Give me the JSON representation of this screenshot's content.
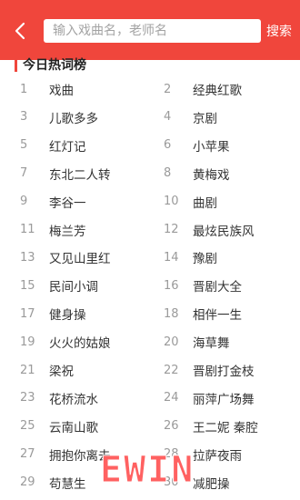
{
  "header": {
    "search_placeholder": "输入戏曲名，老师名",
    "search_button": "搜索",
    "accent_color": "#f0463c"
  },
  "section": {
    "title": "今日热词榜"
  },
  "hot_words": [
    {
      "rank": "1",
      "word": "戏曲"
    },
    {
      "rank": "2",
      "word": "经典红歌"
    },
    {
      "rank": "3",
      "word": "儿歌多多"
    },
    {
      "rank": "4",
      "word": "京剧"
    },
    {
      "rank": "5",
      "word": "红灯记"
    },
    {
      "rank": "6",
      "word": "小苹果"
    },
    {
      "rank": "7",
      "word": "东北二人转"
    },
    {
      "rank": "8",
      "word": "黄梅戏"
    },
    {
      "rank": "9",
      "word": "李谷一"
    },
    {
      "rank": "10",
      "word": "曲剧"
    },
    {
      "rank": "11",
      "word": "梅兰芳"
    },
    {
      "rank": "12",
      "word": "最炫民族风"
    },
    {
      "rank": "13",
      "word": "又见山里红"
    },
    {
      "rank": "14",
      "word": "豫剧"
    },
    {
      "rank": "15",
      "word": "民间小调"
    },
    {
      "rank": "16",
      "word": "晋剧大全"
    },
    {
      "rank": "17",
      "word": "健身操"
    },
    {
      "rank": "18",
      "word": "相伴一生"
    },
    {
      "rank": "19",
      "word": "火火的姑娘"
    },
    {
      "rank": "20",
      "word": "海草舞"
    },
    {
      "rank": "21",
      "word": "梁祝"
    },
    {
      "rank": "22",
      "word": "晋剧打金枝"
    },
    {
      "rank": "23",
      "word": "花桥流水"
    },
    {
      "rank": "24",
      "word": "丽萍广场舞"
    },
    {
      "rank": "25",
      "word": "云南山歌"
    },
    {
      "rank": "26",
      "word": "王二妮 秦腔"
    },
    {
      "rank": "27",
      "word": "拥抱你离去"
    },
    {
      "rank": "28",
      "word": "拉萨夜雨"
    },
    {
      "rank": "29",
      "word": "苟慧生"
    },
    {
      "rank": "30",
      "word": "减肥操"
    }
  ],
  "watermark": "EWIN"
}
